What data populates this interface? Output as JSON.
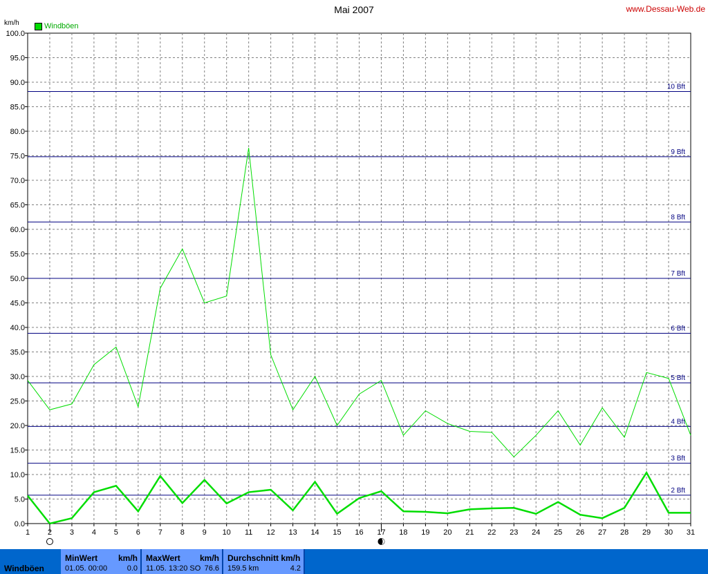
{
  "page": {
    "title": "Mai 2007",
    "site": "www.Dessau-Web.de",
    "unit_label": "km/h",
    "legend_label": "Windböen"
  },
  "colors": {
    "series": "#00dd00",
    "beaufort_lines": "#000080",
    "grid": "#808080",
    "stats_bg": "#0066cc",
    "stats_box": "#6699ff"
  },
  "chart_data": {
    "type": "line",
    "title": "Mai 2007",
    "ylabel": "km/h",
    "ylim": [
      0,
      100
    ],
    "xlim": [
      1,
      31
    ],
    "grid": true,
    "legend": "top-left",
    "x_ticks": [
      1,
      2,
      3,
      4,
      5,
      6,
      7,
      8,
      9,
      10,
      11,
      12,
      13,
      14,
      15,
      16,
      17,
      18,
      19,
      20,
      21,
      22,
      23,
      24,
      25,
      26,
      27,
      28,
      29,
      30,
      31
    ],
    "y_ticks": [
      "0.0",
      "5.0",
      "10.0",
      "15.0",
      "20.0",
      "25.0",
      "30.0",
      "35.0",
      "40.0",
      "45.0",
      "50.0",
      "55.0",
      "60.0",
      "65.0",
      "70.0",
      "75.0",
      "80.0",
      "85.0",
      "90.0",
      "95.0",
      "100.0"
    ],
    "series": [
      {
        "name": "Windböen",
        "values": [
          29.2,
          23.2,
          24.4,
          32.4,
          36.0,
          23.8,
          48.0,
          56.0,
          45.0,
          46.4,
          76.6,
          34.4,
          23.2,
          30.0,
          20.0,
          26.4,
          29.2,
          18.0,
          23.0,
          20.4,
          18.8,
          18.6,
          13.6,
          18.0,
          23.0,
          16.0,
          23.6,
          17.6,
          30.8,
          29.6,
          18.0
        ]
      },
      {
        "values": [
          5.7,
          0.0,
          1.1,
          6.4,
          7.7,
          2.5,
          9.7,
          4.2,
          8.9,
          4.1,
          6.4,
          6.9,
          2.7,
          8.5,
          2.0,
          5.2,
          6.6,
          2.5,
          2.4,
          2.1,
          2.9,
          3.1,
          3.2,
          2.0,
          4.4,
          1.8,
          1.1,
          3.2,
          10.4,
          2.2,
          2.2
        ]
      }
    ],
    "beaufort_lines": [
      {
        "label": "2 Bft",
        "value": 5.8
      },
      {
        "label": "3 Bft",
        "value": 12.3
      },
      {
        "label": "4 Bft",
        "value": 19.8
      },
      {
        "label": "5 Bft",
        "value": 28.7
      },
      {
        "label": "6 Bft",
        "value": 38.8
      },
      {
        "label": "7 Bft",
        "value": 50.0
      },
      {
        "label": "8 Bft",
        "value": 61.5
      },
      {
        "label": "9 Bft",
        "value": 74.8
      },
      {
        "label": "10 Bft",
        "value": 88.1
      }
    ],
    "moon_markers": [
      {
        "day": 2,
        "phase": "full-moon-icon"
      },
      {
        "day": 17,
        "phase": "new-moon-icon"
      }
    ]
  },
  "stats": {
    "row_label": "Windböen",
    "min": {
      "header": "MinWert",
      "unit": "km/h",
      "time": "01.05.  00:00",
      "value": "0.0"
    },
    "max": {
      "header": "MaxWert",
      "unit": "km/h",
      "time": "11.05.  13:20 SO",
      "value": "76.6"
    },
    "avg": {
      "header": "Durchschnitt km/h",
      "distance": "159.5 km",
      "value": "4.2"
    }
  }
}
